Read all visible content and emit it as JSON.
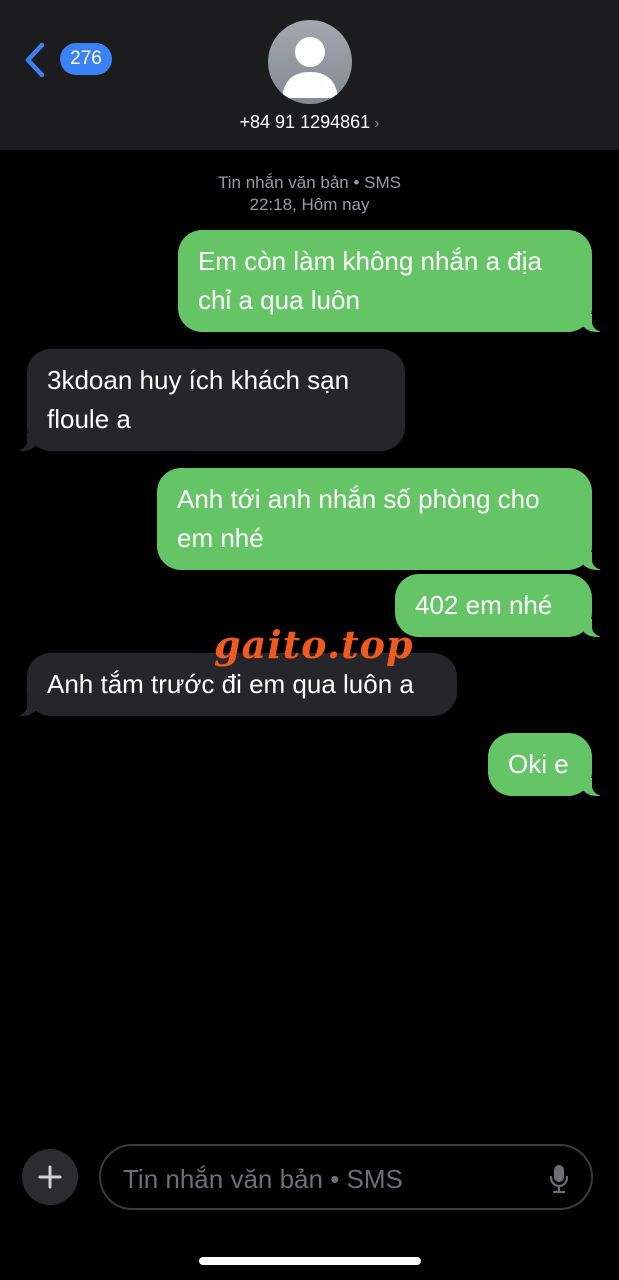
{
  "header": {
    "back_badge": "276",
    "contact": "+84 91 1294861",
    "chevron": "›"
  },
  "thread": {
    "service_label": "Tin nhắn văn bản • SMS",
    "timestamp": "22:18, Hôm nay"
  },
  "messages": [
    {
      "direction": "outgoing",
      "text": "Em còn làm không nhắn a địa chỉ a qua luôn"
    },
    {
      "direction": "incoming",
      "text": "3kdoan huy ích khách sạn floule a"
    },
    {
      "direction": "outgoing",
      "text": "Anh tới anh nhắn số phòng cho em nhé"
    },
    {
      "direction": "outgoing",
      "text": "402 em nhé"
    },
    {
      "direction": "incoming",
      "text": "Anh tắm trước đi em qua luôn a"
    },
    {
      "direction": "outgoing",
      "text": "Oki e"
    }
  ],
  "watermark": "gaito.top",
  "composer": {
    "placeholder": "Tin nhắn văn bản • SMS"
  },
  "colors": {
    "outgoing_bubble": "#65c466",
    "incoming_bubble": "#26262a",
    "badge": "#3a82f6",
    "back_chevron": "#3a82f6",
    "watermark": "#f05a1e"
  },
  "icons": [
    "back-chevron-icon",
    "person-avatar-icon",
    "chevron-right-icon",
    "plus-icon",
    "microphone-icon"
  ]
}
